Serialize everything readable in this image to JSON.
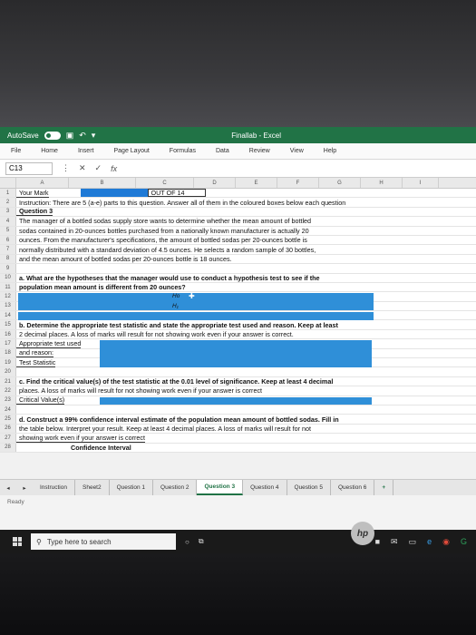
{
  "titlebar": {
    "autosave": "AutoSave",
    "autosave_state": "On",
    "title": "Finallab - Excel"
  },
  "menu": [
    "File",
    "Home",
    "Insert",
    "Page Layout",
    "Formulas",
    "Data",
    "Review",
    "View",
    "Help"
  ],
  "formula": {
    "cell_ref": "C13",
    "cancel": "✕",
    "confirm": "✓",
    "fx": "fx",
    "value": ""
  },
  "columns": [
    "A",
    "B",
    "C",
    "D",
    "E",
    "F",
    "G",
    "H",
    "I"
  ],
  "rows": [
    {
      "n": "1",
      "text": "Your Mark",
      "extra": "OUT OF  14"
    },
    {
      "n": "2",
      "text": "Instruction: There are 5 (a-e) parts to this question. Answer all of them in the coloured boxes below each question"
    },
    {
      "n": "3",
      "text": "Question 3"
    },
    {
      "n": "4",
      "text": "The manager of a bottled sodas supply store wants to determine whether the mean amount of bottled"
    },
    {
      "n": "5",
      "text": "sodas contained in 20-ounces bottles purchased from a nationally known manufacturer is actually 20"
    },
    {
      "n": "6",
      "text": "ounces. From the manufacturer's specifications, the amount of bottled sodas per 20-ounces bottle is"
    },
    {
      "n": "7",
      "text": "normally distributed with a standard deviation of 4.5 ounces. He selects a random sample of 30 bottles,"
    },
    {
      "n": "8",
      "text": "and the mean amount of bottled sodas per 20-ounces bottle is 18 ounces."
    },
    {
      "n": "9",
      "text": ""
    },
    {
      "n": "10",
      "text": "a. What are the hypotheses that the manager would use to conduct a hypothesis test to see if the"
    },
    {
      "n": "11",
      "text": "population mean amount is different from 20 ounces?"
    },
    {
      "n": "12",
      "text": ""
    },
    {
      "n": "13",
      "text": ""
    },
    {
      "n": "14",
      "text": ""
    },
    {
      "n": "15",
      "text": "b. Determine the appropriate test statistic and state the appropriate test used and reason. Keep at least"
    },
    {
      "n": "16",
      "text": "2 decimal places. A loss of marks will result for not showing work even if your answer is correct."
    },
    {
      "n": "17",
      "text": "Appropriate test used"
    },
    {
      "n": "18",
      "text": "and reason:"
    },
    {
      "n": "19",
      "text": "Test Statistic"
    },
    {
      "n": "20",
      "text": ""
    },
    {
      "n": "21",
      "text": "c. Find the critical value(s) of the test statistic at the 0.01 level of significance. Keep at least 4 decimal"
    },
    {
      "n": "22",
      "text": "places. A loss of marks will result for not showing work even if your answer is correct"
    },
    {
      "n": "23",
      "text": "Critical Value(s)"
    },
    {
      "n": "24",
      "text": ""
    },
    {
      "n": "25",
      "text": "d. Construct a 99% confidence interval estimate of the population mean amount of bottled sodas. Fill in"
    },
    {
      "n": "26",
      "text": "the table below. Interpret your result. Keep at least 4 decimal places. A loss of marks will result for not"
    },
    {
      "n": "27",
      "text": "showing work even if your answer is correct"
    },
    {
      "n": "28",
      "text": "Confidence Interval"
    }
  ],
  "hypotheses": {
    "h0": "Ho",
    "h1": "H₁"
  },
  "tabs": [
    "Instruction",
    "Sheet2",
    "Question 1",
    "Question 2",
    "Question 3",
    "Question 4",
    "Question 5",
    "Question 6"
  ],
  "active_tab": "Question 3",
  "add_tab": "+",
  "status": "Ready",
  "taskbar": {
    "search_placeholder": "Type here to search"
  },
  "brand": "hp"
}
